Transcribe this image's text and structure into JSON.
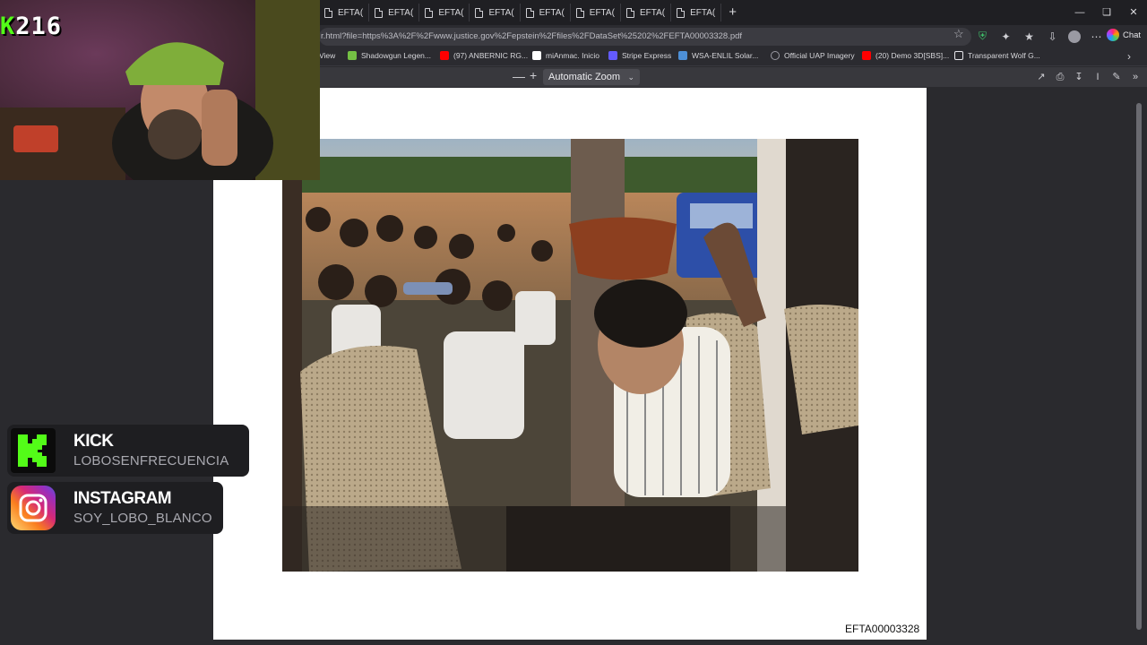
{
  "browser": {
    "tabs": [
      "EFTA(",
      "EFTA(",
      "EFTA(",
      "EFTA(",
      "EFTA(",
      "EFTA(",
      "EFTA(",
      "EFTA("
    ],
    "new_tab_label": "+",
    "url": "r.html?file=https%3A%2F%2Fwww.justice.gov%2Fepstein%2Ffiles%2FDataSet%25202%2FEFTA00003328.pdf",
    "chat_label": "Chat",
    "window_controls": [
      "—",
      "❏",
      "✕"
    ]
  },
  "bookmarks": [
    {
      "label": "View",
      "color": "#2b2b30"
    },
    {
      "label": "Shadowgun Legen...",
      "color": "#74c044"
    },
    {
      "label": "(97) ANBERNIC RG...",
      "color": "#ff0000"
    },
    {
      "label": "miAnmac. Inicio",
      "color": "#ffffff"
    },
    {
      "label": "Stripe Express",
      "color": "#635bff"
    },
    {
      "label": "WSA-ENLIL Solar...",
      "color": "#4d8fd6"
    },
    {
      "label": "Official UAP Imagery",
      "color": "#9a9aa3"
    },
    {
      "label": "(20) Demo 3D[SBS]...",
      "color": "#ff0000"
    },
    {
      "label": "Transparent Wolf G...",
      "color": "#e6e6ea"
    }
  ],
  "pdf_toolbar": {
    "zoom_out": "—",
    "zoom_in": "+",
    "zoom_value": "Automatic Zoom"
  },
  "document": {
    "page_id": "EFTA00003328"
  },
  "stream_overlay": {
    "sub_prefix": "K",
    "sub_count": "216",
    "kick": {
      "title": "KICK",
      "handle": "LOBOSENFRECUENCIA"
    },
    "instagram": {
      "title": "INSTAGRAM",
      "handle": "SOY_LOBO_BLANCO"
    }
  },
  "colors": {
    "kick_green": "#53fc18",
    "page_bg": "#ffffff",
    "viewer_bg": "#2a2a2e"
  }
}
